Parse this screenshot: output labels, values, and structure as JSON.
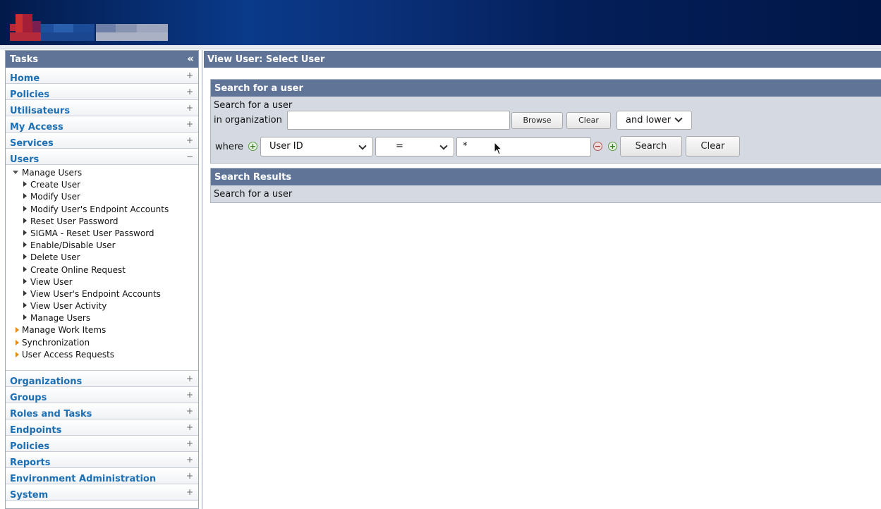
{
  "sidebar": {
    "title": "Tasks",
    "collapse_icon": "«",
    "top_categories": [
      {
        "label": "Home",
        "toggle": "+"
      },
      {
        "label": "Policies",
        "toggle": "+"
      },
      {
        "label": "Utilisateurs",
        "toggle": "+"
      },
      {
        "label": "My Access",
        "toggle": "+"
      },
      {
        "label": "Services",
        "toggle": "+"
      },
      {
        "label": "Users",
        "toggle": "−"
      }
    ],
    "tree": {
      "manage_users": "Manage Users",
      "items": [
        "Create User",
        "Modify User",
        "Modify User's Endpoint Accounts",
        "Reset User Password",
        "SIGMA - Reset User Password",
        "Enable/Disable User",
        "Delete User",
        "Create Online Request",
        "View User",
        "View User's Endpoint Accounts",
        "View User Activity",
        "Manage Users"
      ],
      "siblings": [
        "Manage Work Items",
        "Synchronization",
        "User Access Requests"
      ]
    },
    "bottom_categories": [
      {
        "label": "Organizations",
        "toggle": "+"
      },
      {
        "label": "Groups",
        "toggle": "+"
      },
      {
        "label": "Roles and Tasks",
        "toggle": "+"
      },
      {
        "label": "Endpoints",
        "toggle": "+"
      },
      {
        "label": "Policies",
        "toggle": "+"
      },
      {
        "label": "Reports",
        "toggle": "+"
      },
      {
        "label": "Environment Administration",
        "toggle": "+"
      },
      {
        "label": "System",
        "toggle": "+"
      }
    ]
  },
  "main": {
    "title": "View User: Select User",
    "search_panel": {
      "title": "Search for a user",
      "line1": "Search for a user",
      "line2": "in organization",
      "org_value": "",
      "browse_label": "Browse",
      "clear_org_label": "Clear",
      "scope_value": "and lower",
      "where_label": "where",
      "attribute_value": "User ID",
      "operator_value": "=",
      "filter_value": "*",
      "search_label": "Search",
      "clear_label": "Clear"
    },
    "results_panel": {
      "title": "Search Results",
      "text": "Search for a user"
    }
  },
  "colors": {
    "header_bar": "#5f7496",
    "link_blue": "#1d6fb4",
    "panel_bg": "#d5dae2",
    "banner_dark": "#021a4a"
  }
}
